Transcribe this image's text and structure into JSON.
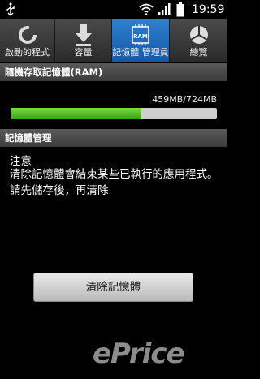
{
  "status_bar": {
    "time": "19:59",
    "icons": [
      "usb-icon",
      "wifi-icon",
      "signal-icon",
      "battery-icon"
    ]
  },
  "tabs": [
    {
      "label": "啟動的程式",
      "icon": "refresh-circle-icon",
      "active": false
    },
    {
      "label": "容量",
      "icon": "download-arrow-icon",
      "active": false
    },
    {
      "label": "記憶體 管理員",
      "icon": "ram-chip-icon",
      "icon_text": "RAM",
      "active": true
    },
    {
      "label": "總覽",
      "icon": "pie-chart-icon",
      "active": false
    }
  ],
  "ram_section": {
    "header": "隨機存取記憶體(RAM)",
    "usage_text": "459MB/724MB",
    "used_fraction": 0.634
  },
  "memory_section": {
    "header": "記憶體管理",
    "notice_title": "注意",
    "notice_body": "清除記憶體會結束某些已執行的應用程式。請先儲存後，再清除",
    "clear_button_label": "清除記憶體"
  },
  "watermark": "ePrice",
  "colors": {
    "active_tab": "#1f6cc0",
    "progress_fill": "#5cc32a",
    "progress_track": "#cfcfcf"
  }
}
